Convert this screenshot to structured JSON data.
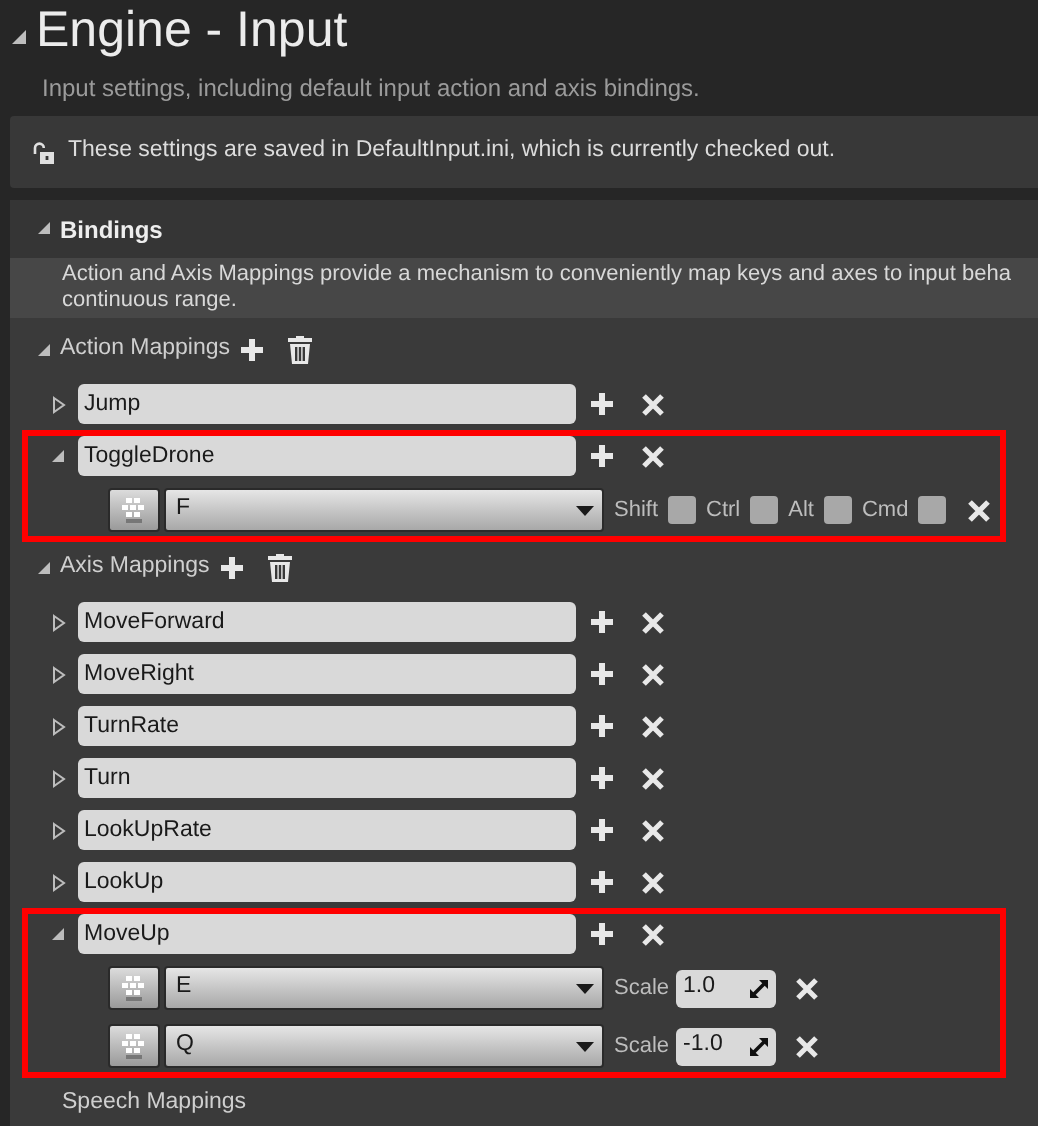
{
  "title": "Engine - Input",
  "description": "Input settings, including default input action and axis bindings.",
  "notice": "These settings are saved in DefaultInput.ini, which is currently checked out.",
  "section": {
    "title": "Bindings",
    "expanded": true,
    "description_lines": [
      "Action and Axis Mappings provide a mechanism to conveniently map keys and axes to input beha",
      "continuous range."
    ],
    "groups": [
      {
        "label": "Action Mappings",
        "expanded": true,
        "mappings": [
          {
            "name": "Jump",
            "expanded": false,
            "highlighted": false
          },
          {
            "name": "ToggleDrone",
            "expanded": true,
            "highlighted": true,
            "keys": [
              {
                "kind": "action",
                "key": "F",
                "modifiers": [
                  {
                    "label": "Shift",
                    "checked": false
                  },
                  {
                    "label": "Ctrl",
                    "checked": false
                  },
                  {
                    "label": "Alt",
                    "checked": false
                  },
                  {
                    "label": "Cmd",
                    "checked": false
                  }
                ]
              }
            ]
          }
        ]
      },
      {
        "label": "Axis Mappings",
        "expanded": true,
        "mappings": [
          {
            "name": "MoveForward",
            "expanded": false,
            "highlighted": false
          },
          {
            "name": "MoveRight",
            "expanded": false,
            "highlighted": false
          },
          {
            "name": "TurnRate",
            "expanded": false,
            "highlighted": false
          },
          {
            "name": "Turn",
            "expanded": false,
            "highlighted": false
          },
          {
            "name": "LookUpRate",
            "expanded": false,
            "highlighted": false
          },
          {
            "name": "LookUp",
            "expanded": false,
            "highlighted": false
          },
          {
            "name": "MoveUp",
            "expanded": true,
            "highlighted": true,
            "keys": [
              {
                "kind": "axis",
                "key": "E",
                "scale_label": "Scale",
                "scale": "1.0"
              },
              {
                "kind": "axis",
                "key": "Q",
                "scale_label": "Scale",
                "scale": "-1.0"
              }
            ]
          }
        ]
      },
      {
        "label": "Speech Mappings"
      }
    ]
  }
}
